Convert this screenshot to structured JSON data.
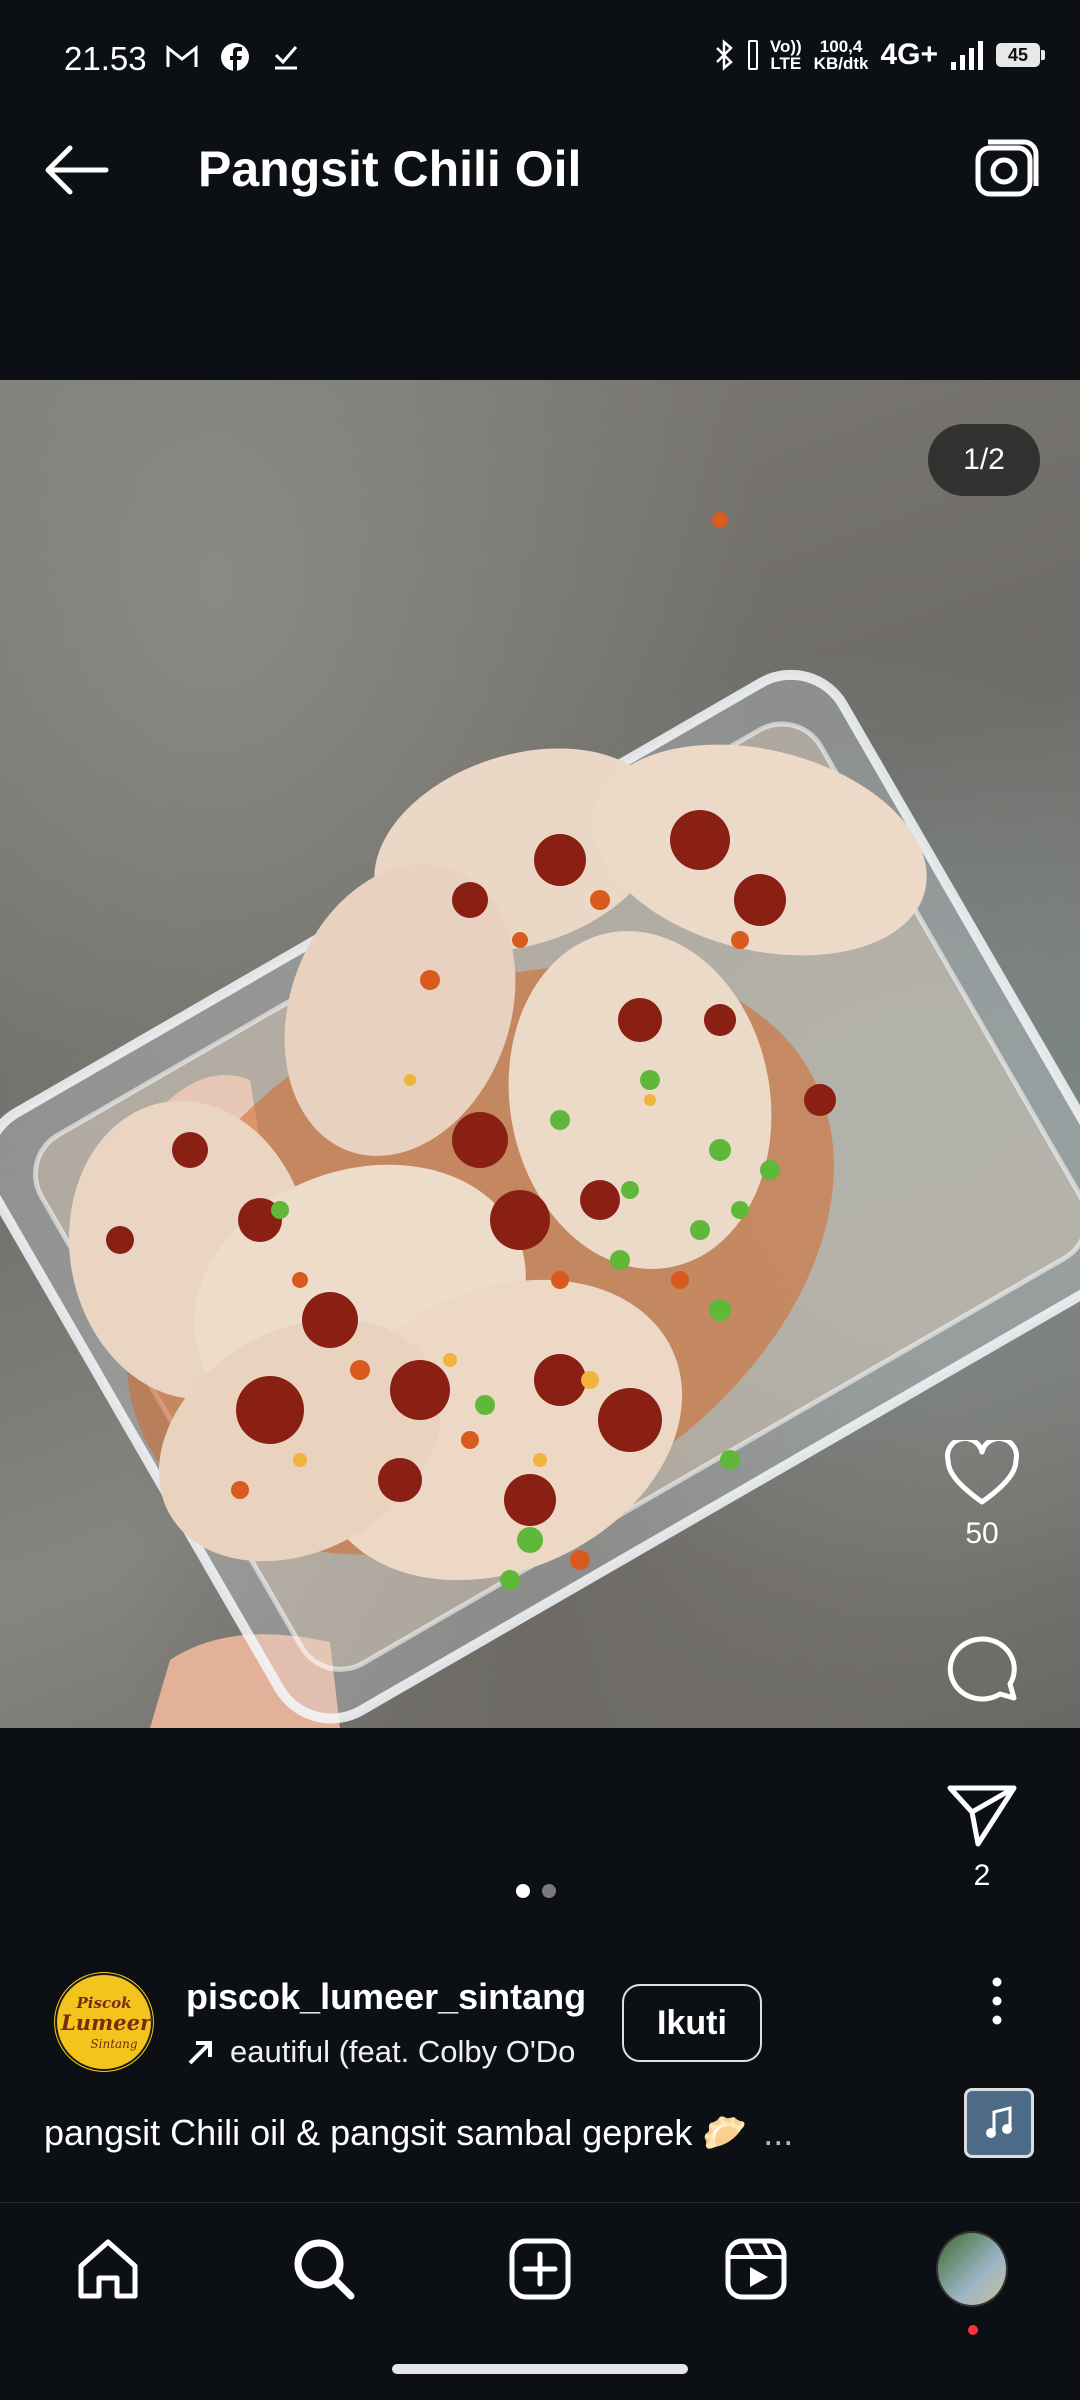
{
  "status_bar": {
    "time": "21.53",
    "net_speed_value": "100,4",
    "net_speed_unit": "KB/dtk",
    "volte_top": "Vo))",
    "volte_bottom": "LTE",
    "network": "4G+",
    "battery": "45",
    "left_icons": [
      "gmail-icon",
      "facebook-icon",
      "download-check-icon"
    ],
    "right_icons": [
      "bluetooth-icon",
      "signal-icon"
    ]
  },
  "header": {
    "title": "Pangsit Chili Oil"
  },
  "post": {
    "image_counter": "1/2",
    "image_alt": "Wonton dumplings with chili oil and green onion in a plastic container",
    "like_count": "50",
    "share_count": "2",
    "carousel": {
      "current": 1,
      "total": 2
    }
  },
  "author": {
    "username": "piscok_lumeer_sintang",
    "avatar_text_1": "Piscok",
    "avatar_text_2": "Lumeer",
    "avatar_text_3": "Sintang",
    "audio": "eautiful (feat. Colby O'Do",
    "follow_label": "Ikuti"
  },
  "caption": {
    "text": "pangsit Chili oil & pangsit sambal geprek 🥟",
    "more": "..."
  },
  "nav": {
    "items": [
      "home-icon",
      "search-icon",
      "create-icon",
      "reels-icon",
      "profile-avatar"
    ]
  },
  "colors": {
    "background": "#0c1014",
    "text": "#f5f5f5",
    "notification": "#ff3040",
    "avatar_yellow": "#f3c51c"
  }
}
